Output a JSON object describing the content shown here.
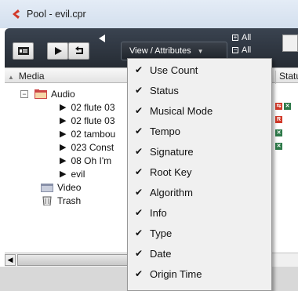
{
  "window": {
    "title": "Pool - evil.cpr"
  },
  "toolbar": {
    "view_label": "View / Attributes",
    "all_labels": [
      "All",
      "All"
    ]
  },
  "header": {
    "media_col": "Media",
    "status_col": "Statu"
  },
  "tree": {
    "audio_label": "Audio",
    "audio_items": [
      "02 flute 03",
      "02 flute 03",
      "02 tambou",
      "023 Const",
      "08 Oh I'm",
      "evil"
    ],
    "video_label": "Video",
    "trash_label": "Trash"
  },
  "menu": {
    "items": [
      "Use Count",
      "Status",
      "Musical Mode",
      "Tempo",
      "Signature",
      "Root Key",
      "Algorithm",
      "Info",
      "Type",
      "Date",
      "Origin Time"
    ]
  },
  "colors": {
    "accent_red": "#d23a2a",
    "accent_green": "#2f7a4a",
    "toolbar_dark": "#262c34"
  }
}
